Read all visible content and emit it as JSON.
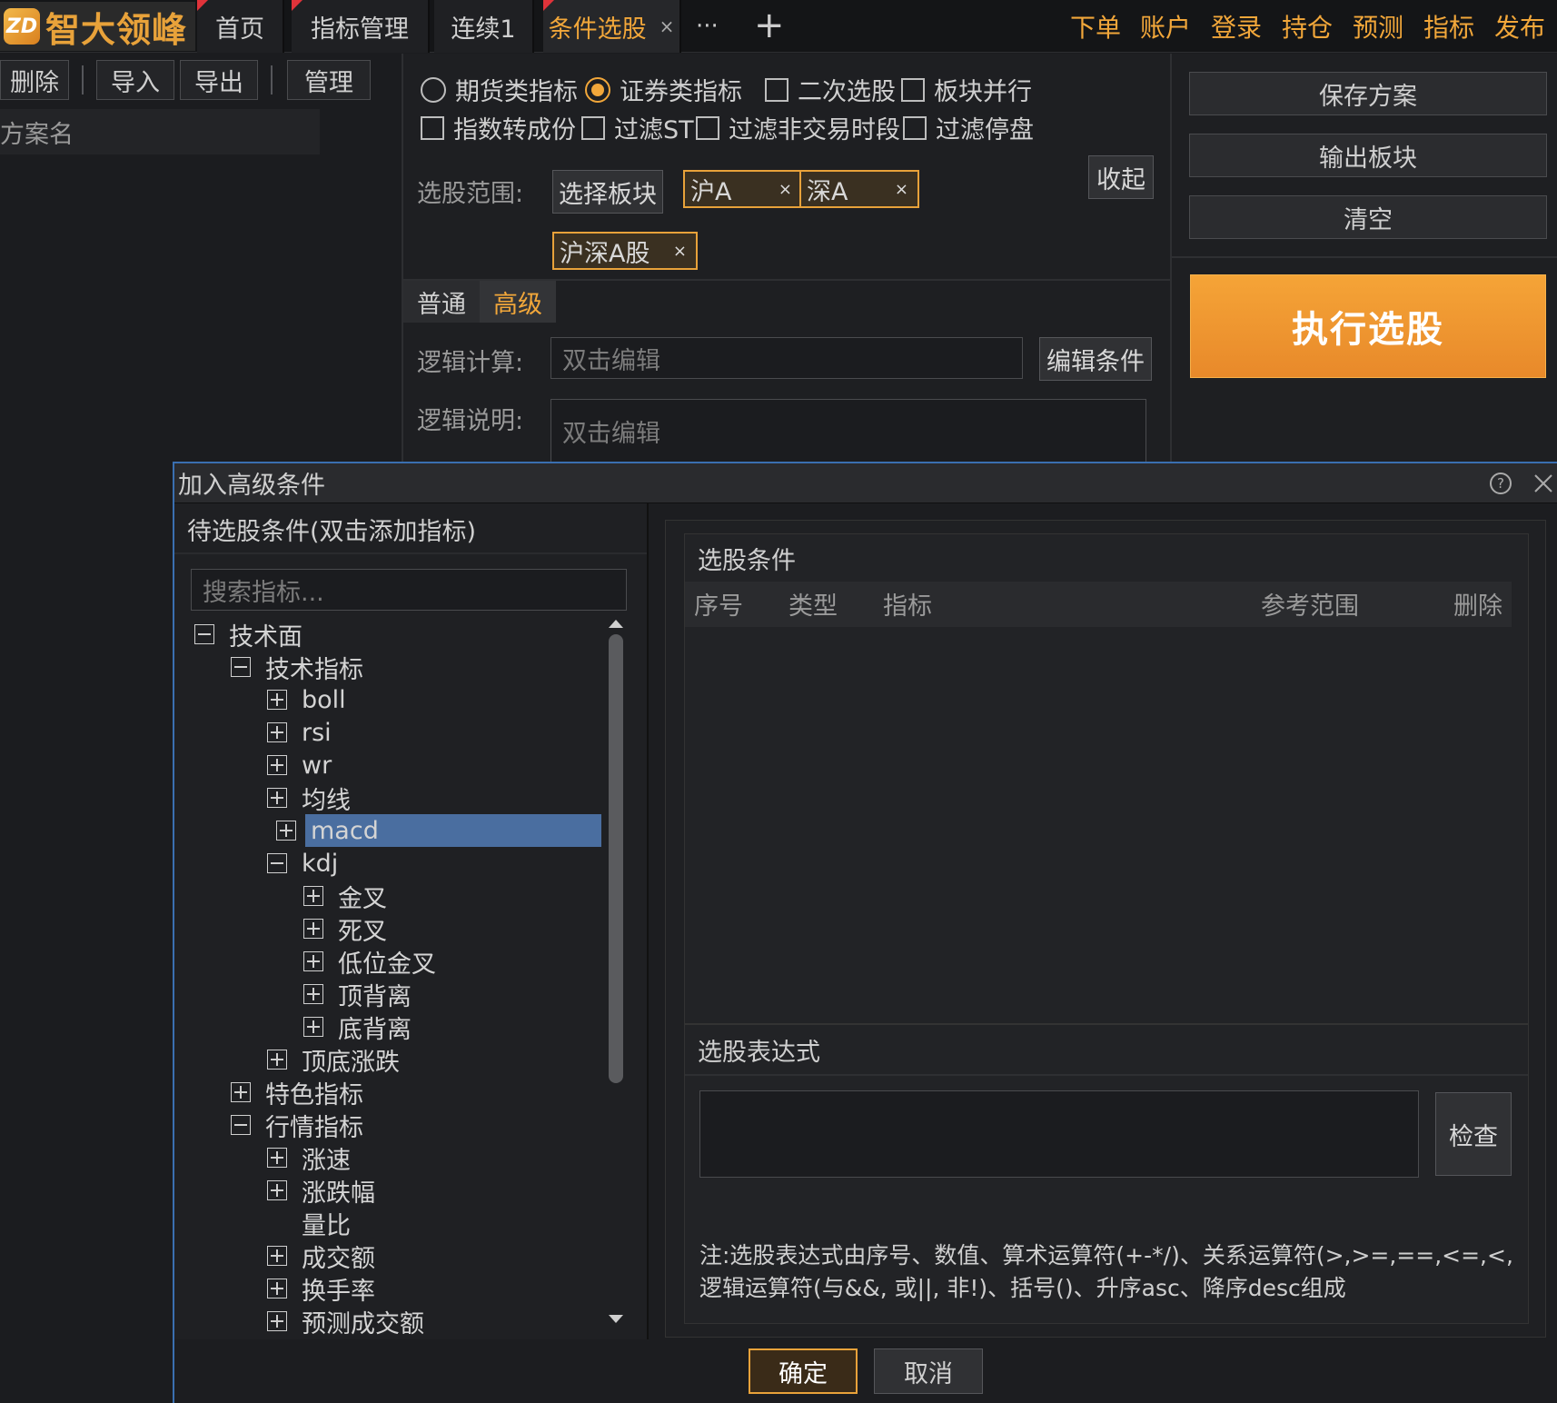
{
  "app": {
    "logo_mark": "ZD",
    "logo_text": "智大领峰"
  },
  "tabs": [
    {
      "label": "首页"
    },
    {
      "label": "指标管理"
    },
    {
      "label": "连续1"
    },
    {
      "label": "条件选股",
      "close": "×"
    }
  ],
  "tab_more": "···",
  "tab_add": "+",
  "top_menu": [
    "下单",
    "账户",
    "登录",
    "持仓",
    "预测",
    "指标",
    "发布"
  ],
  "left_toolbar": {
    "delete": "删除",
    "import": "导入",
    "export": "导出",
    "manage": "管理"
  },
  "scheme_header": "方案名",
  "config": {
    "opt_futures": "期货类指标",
    "opt_securities": "证券类指标",
    "opt_secondary": "二次选股",
    "opt_parallel": "板块并行",
    "opt_index_components": "指数转成份",
    "opt_filter_st": "过滤ST",
    "opt_filter_nontrading": "过滤非交易时段",
    "opt_filter_halt": "过滤停盘",
    "selected_type": "证券类指标",
    "scope_label": "选股范围:",
    "select_block": "选择板块",
    "collapse": "收起",
    "chips": [
      "沪A",
      "深A",
      "沪深A股"
    ],
    "chip_close": "×",
    "mode_normal": "普通",
    "mode_advanced": "高级",
    "logic_calc_label": "逻辑计算:",
    "logic_calc_placeholder": "双击编辑",
    "edit_condition": "编辑条件",
    "logic_desc_label": "逻辑说明:",
    "logic_desc_placeholder": "双击编辑"
  },
  "right_actions": {
    "save": "保存方案",
    "output": "输出板块",
    "clear": "清空",
    "execute": "执行选股"
  },
  "dialog": {
    "title": "加入高级条件",
    "left_header": "待选股条件(双击添加指标)",
    "search_placeholder": "搜索指标...",
    "tree": [
      {
        "label": "技术面",
        "level": 0,
        "toggle": "minus"
      },
      {
        "label": "技术指标",
        "level": 1,
        "toggle": "minus"
      },
      {
        "label": "boll",
        "level": 2,
        "toggle": "plus"
      },
      {
        "label": "rsi",
        "level": 2,
        "toggle": "plus"
      },
      {
        "label": "wr",
        "level": 2,
        "toggle": "plus"
      },
      {
        "label": "均线",
        "level": 2,
        "toggle": "plus"
      },
      {
        "label": "macd",
        "level": 2,
        "toggle": "plus",
        "selected": true
      },
      {
        "label": "kdj",
        "level": 2,
        "toggle": "minus"
      },
      {
        "label": "金叉",
        "level": 3,
        "toggle": "plus"
      },
      {
        "label": "死叉",
        "level": 3,
        "toggle": "plus"
      },
      {
        "label": "低位金叉",
        "level": 3,
        "toggle": "plus"
      },
      {
        "label": "顶背离",
        "level": 3,
        "toggle": "plus"
      },
      {
        "label": "底背离",
        "level": 3,
        "toggle": "plus"
      },
      {
        "label": "顶底涨跌",
        "level": 2,
        "toggle": "plus"
      },
      {
        "label": "特色指标",
        "level": 1,
        "toggle": "plus"
      },
      {
        "label": "行情指标",
        "level": 1,
        "toggle": "minus"
      },
      {
        "label": "涨速",
        "level": 2,
        "toggle": "plus"
      },
      {
        "label": "涨跌幅",
        "level": 2,
        "toggle": "plus"
      },
      {
        "label": "量比",
        "level": 2,
        "toggle": "none"
      },
      {
        "label": "成交额",
        "level": 2,
        "toggle": "plus"
      },
      {
        "label": "换手率",
        "level": 2,
        "toggle": "plus"
      },
      {
        "label": "预测成交额",
        "level": 2,
        "toggle": "plus"
      }
    ],
    "conditions_title": "选股条件",
    "columns": [
      "序号",
      "类型",
      "指标",
      "参考范围",
      "删除"
    ],
    "expr_title": "选股表达式",
    "check": "检查",
    "note_line1": "注:选股表达式由序号、数值、算术运算符(+-*/)、关系运算符(>,>=,==,<=,<,",
    "note_line2": "逻辑运算符(与&&, 或||, 非!)、括号()、升序asc、降序desc组成",
    "ok": "确定",
    "cancel": "取消"
  },
  "colors": {
    "accent": "#f2a73a",
    "selection": "#4a6ea0",
    "dialog_border": "#3a6fb0"
  }
}
